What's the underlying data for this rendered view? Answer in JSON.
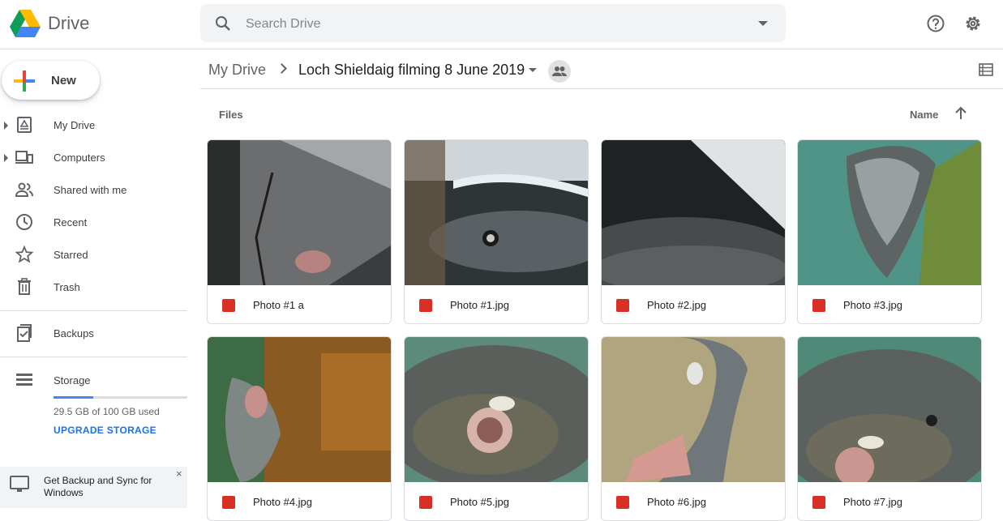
{
  "app": {
    "name": "Drive"
  },
  "search": {
    "placeholder": "Search Drive"
  },
  "sidebar": {
    "new_label": "New",
    "items": [
      {
        "label": "My Drive",
        "icon": "my-drive-icon"
      },
      {
        "label": "Computers",
        "icon": "computers-icon"
      },
      {
        "label": "Shared with me",
        "icon": "shared-with-me-icon"
      },
      {
        "label": "Recent",
        "icon": "clock-icon"
      },
      {
        "label": "Starred",
        "icon": "star-icon"
      },
      {
        "label": "Trash",
        "icon": "trash-icon"
      },
      {
        "label": "Backups",
        "icon": "backups-icon"
      }
    ],
    "storage": {
      "label": "Storage",
      "used_text": "29.5 GB of 100 GB used",
      "used_fraction": 0.295,
      "upgrade_label": "UPGRADE STORAGE"
    },
    "promo": {
      "text": "Get Backup and Sync for Windows",
      "close": "×"
    }
  },
  "breadcrumb": {
    "root": "My Drive",
    "current": "Loch Shieldaig filming 8 June 2019"
  },
  "files": {
    "section_label": "Files",
    "sort_label": "Name",
    "items": [
      {
        "name": "Photo #1 a"
      },
      {
        "name": "Photo #1.jpg"
      },
      {
        "name": "Photo #2.jpg"
      },
      {
        "name": "Photo #3.jpg"
      },
      {
        "name": "Photo #4.jpg"
      },
      {
        "name": "Photo #5.jpg"
      },
      {
        "name": "Photo #6.jpg"
      },
      {
        "name": "Photo #7.jpg"
      }
    ]
  },
  "colors": {
    "accent": "#1a73e8",
    "image_icon": "#d93025",
    "storage_bar": "#4285f4"
  }
}
